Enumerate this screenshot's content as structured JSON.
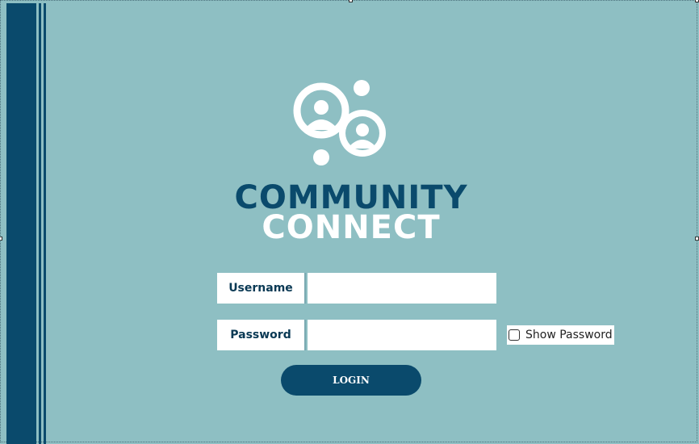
{
  "brand": {
    "line1": "COMMUNITY",
    "line2": "CONNECT",
    "logo_icon": "community-people-icon"
  },
  "form": {
    "username_label": "Username",
    "username_value": "",
    "password_label": "Password",
    "password_value": "",
    "show_password_label": "Show Password",
    "show_password_checked": false,
    "login_label": "LOGIN"
  },
  "colors": {
    "background": "#8ebfc3",
    "navy": "#0a4a6c",
    "white": "#ffffff"
  }
}
